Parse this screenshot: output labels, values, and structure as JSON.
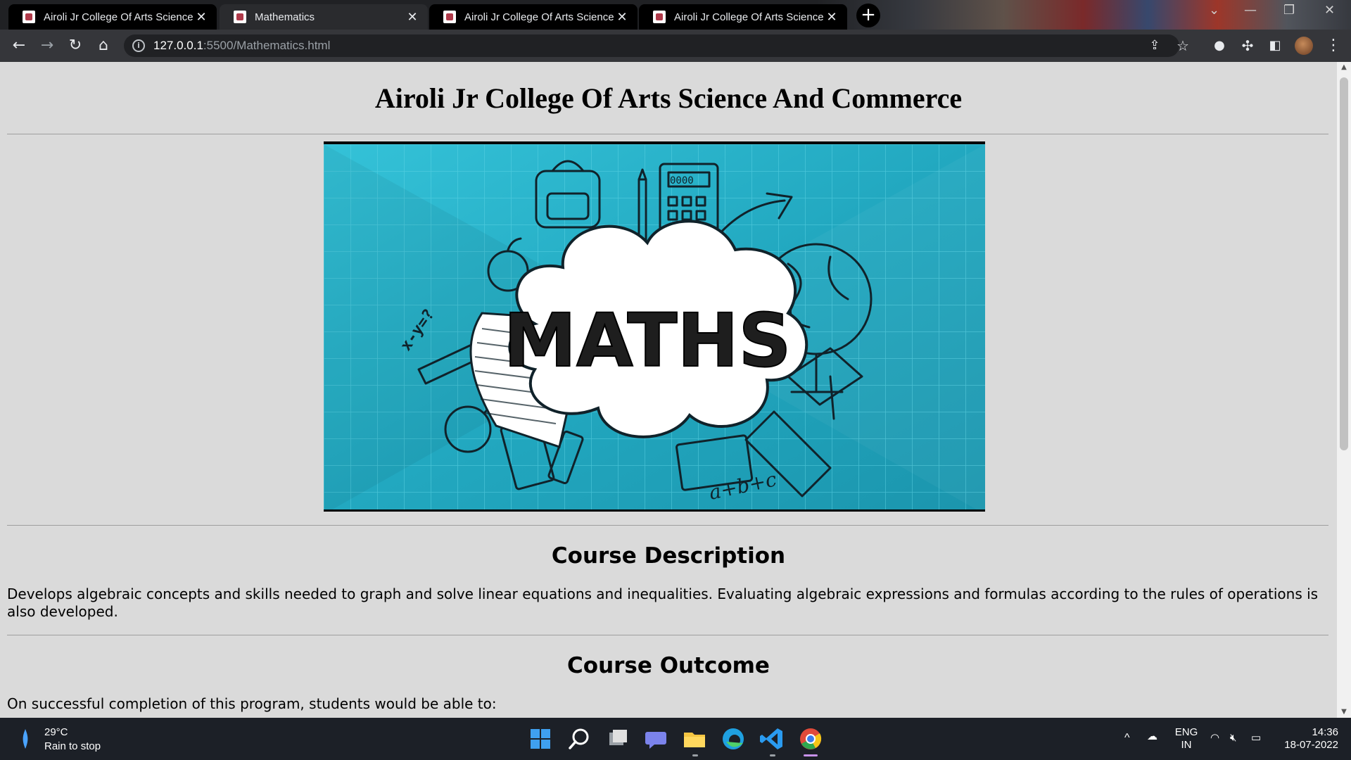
{
  "browser": {
    "tabs": [
      {
        "title": "Airoli Jr College Of Arts Science And Commerce"
      },
      {
        "title": "Mathematics"
      },
      {
        "title": "Airoli Jr College Of Arts Science And Commerce"
      },
      {
        "title": "Airoli Jr College Of Arts Science And Commerce"
      }
    ],
    "new_tab_label": "+",
    "url_host": "127.0.0.1",
    "url_rest": ":5500/Mathematics.html"
  },
  "page": {
    "site_title": "Airoli Jr College Of Arts Science And Commerce",
    "hero_image": {
      "main_text": "MATHS",
      "doodle_formula": "x-y=?",
      "doodle_sum": "a+b+c",
      "calc_digits": "0000"
    },
    "course_description_heading": "Course Description",
    "course_description_text": "Develops algebraic concepts and skills needed to graph and solve linear equations and inequalities. Evaluating algebraic expressions and formulas according to the rules of operations is also developed.",
    "course_outcome_heading": "Course Outcome",
    "course_outcome_intro": "On successful completion of this program, students would be able to:"
  },
  "taskbar": {
    "weather_temp": "29°C",
    "weather_desc": "Rain to stop",
    "lang_top": "ENG",
    "lang_bottom": "IN",
    "time": "14:36",
    "date": "18-07-2022"
  },
  "colors": {
    "page_bg": "#dadada",
    "hero_bg": "#2ab4cc",
    "tabstrip_bg": "#202124",
    "toolbar_bg": "#35363a",
    "taskbar_bg": "#1c2027"
  }
}
